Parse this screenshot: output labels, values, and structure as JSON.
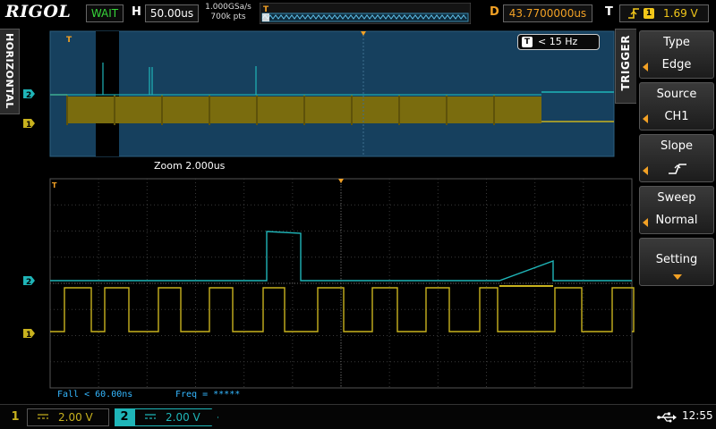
{
  "header": {
    "brand": "RIGOL",
    "run_status": "WAIT",
    "horizontal_label": "H",
    "timebase": "50.00us",
    "sample_rate": "1.000GSa/s",
    "memory_depth": "700k pts",
    "delay_label": "D",
    "delay": "43.7700000us",
    "trigger_label": "T",
    "trigger_source_badge": "1",
    "trigger_level": "1.69 V"
  },
  "left_tab": {
    "label": "HORIZONTAL"
  },
  "display": {
    "freq_badge": "< 15 Hz",
    "freq_badge_icon": "T",
    "zoom_label": "Zoom  2.000us",
    "measure_fall": "Fall < 60.00ns",
    "measure_freq": "Freq = *****",
    "ch1_marker": "1",
    "ch2_marker": "2",
    "trigger_marker": "T"
  },
  "menu": {
    "title": "TRIGGER",
    "items": [
      {
        "title": "Type",
        "value": "Edge"
      },
      {
        "title": "Source",
        "value": "CH1"
      },
      {
        "title": "Slope",
        "value": ""
      },
      {
        "title": "Sweep",
        "value": "Normal"
      },
      {
        "title": "Setting",
        "value": ""
      }
    ]
  },
  "footer": {
    "ch1": {
      "number": "1",
      "scale": "2.00 V"
    },
    "ch2": {
      "number": "2",
      "scale": "2.00 V"
    },
    "time": "12:55"
  },
  "colors": {
    "ch1": "#c8b21e",
    "ch2": "#1fb5b8",
    "accent": "#f2a125",
    "trigger": "#f2c71a"
  },
  "icons": [
    "edge-rising-icon",
    "usb-icon",
    "dc-coupling-icon",
    "slope-rising-icon"
  ]
}
